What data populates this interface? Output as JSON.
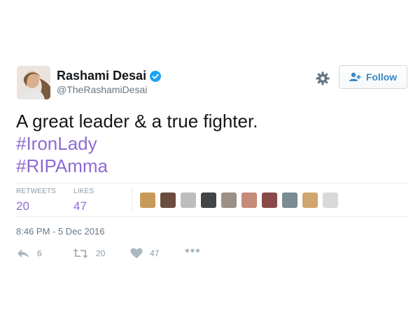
{
  "author": {
    "display_name": "Rashami Desai",
    "handle": "@TheRashamiDesai",
    "verified": true
  },
  "follow_button": {
    "label": "Follow"
  },
  "tweet": {
    "text_lines": [
      "A great leader & a true fighter.",
      "#IronLady",
      "#RIPAmma"
    ],
    "timestamp": "8:46 PM - 5 Dec 2016"
  },
  "stats": {
    "retweets": {
      "label": "RETWEETS",
      "value": "20"
    },
    "likes": {
      "label": "LIKES",
      "value": "47"
    }
  },
  "likers": [
    {
      "color": "#c89a5a"
    },
    {
      "color": "#6b4d3e"
    },
    {
      "color": "#bdbdbd"
    },
    {
      "color": "#444444"
    },
    {
      "color": "#9b8f86"
    },
    {
      "color": "#c58c7a"
    },
    {
      "color": "#8a4a4a"
    },
    {
      "color": "#7c8b92"
    },
    {
      "color": "#d0a56f"
    },
    {
      "color": "#d9d9d9"
    }
  ],
  "actions": {
    "reply": {
      "icon": "reply-icon",
      "count": "6"
    },
    "retweet": {
      "icon": "retweet-icon",
      "count": "20"
    },
    "like": {
      "icon": "heart-icon",
      "count": "47"
    },
    "more": {
      "icon": "more-icon"
    }
  },
  "colors": {
    "hashtag": "#8e6cd2",
    "follow_text": "#3b88c3",
    "verified_badge": "#1da1f2",
    "muted": "#657786"
  }
}
